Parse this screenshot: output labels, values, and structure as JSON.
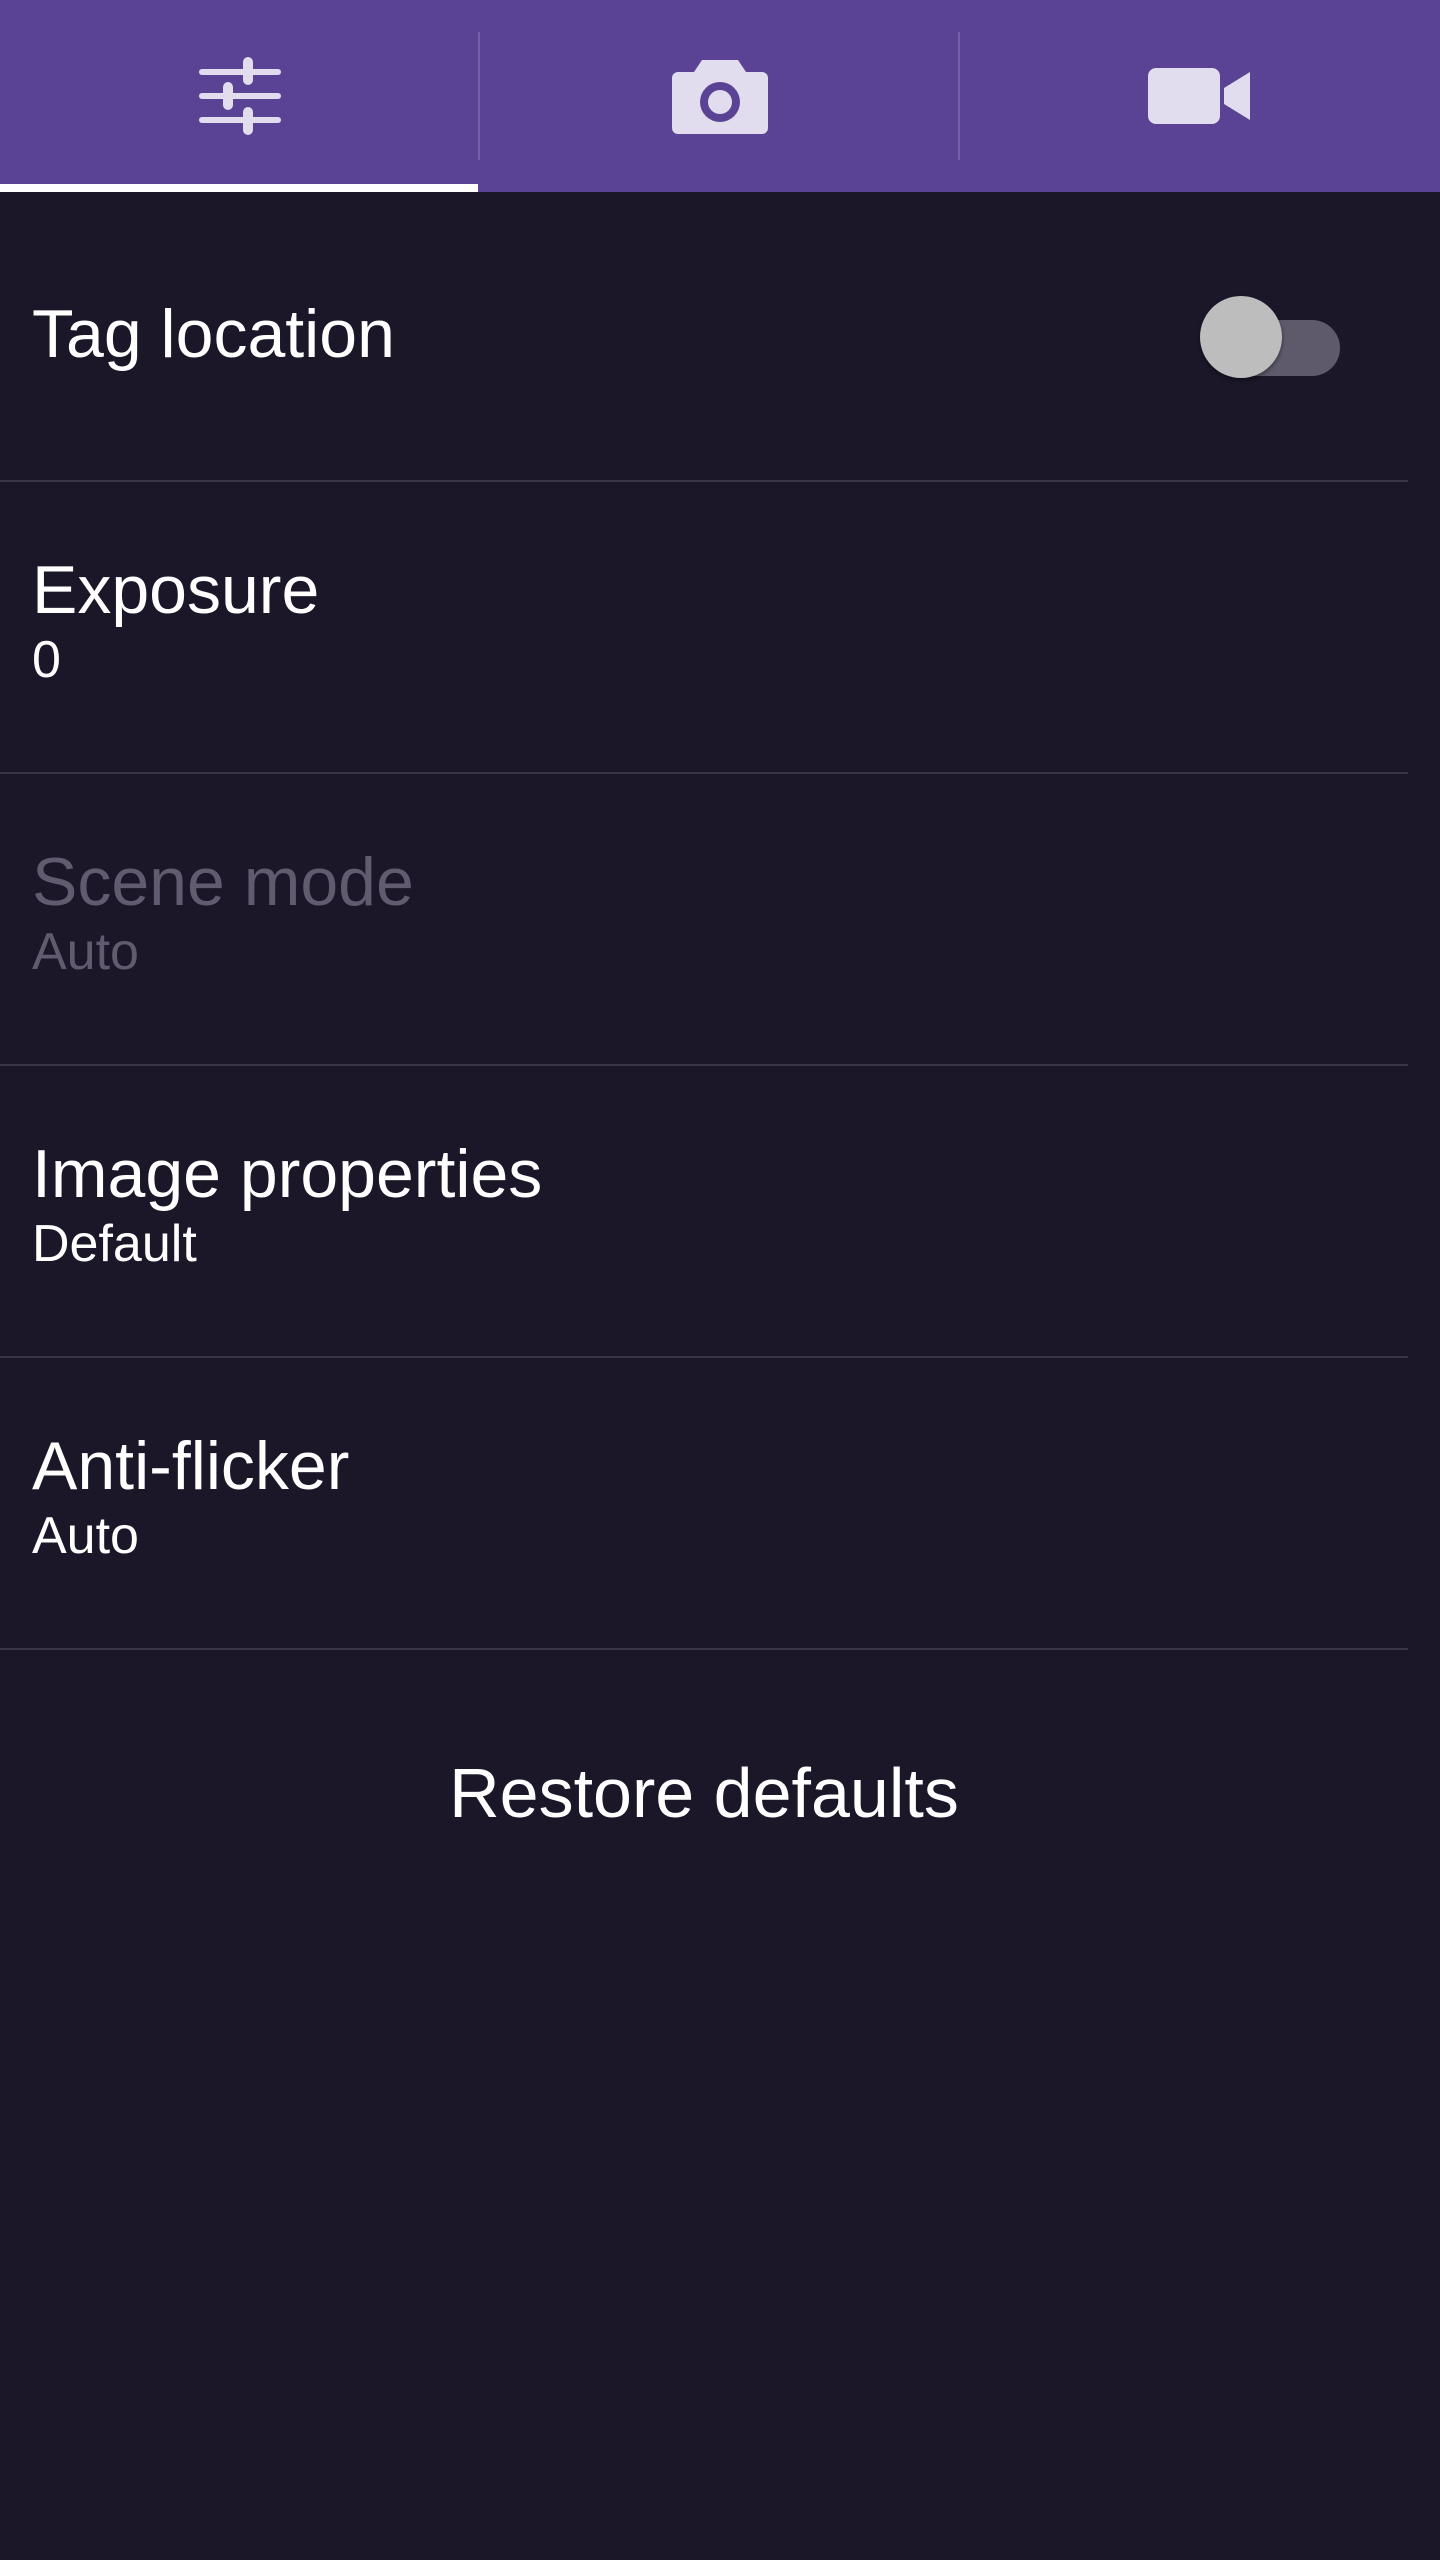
{
  "tabs": [
    {
      "icon": "sliders-icon",
      "selected": true
    },
    {
      "icon": "camera-icon",
      "selected": false
    },
    {
      "icon": "video-camera-icon",
      "selected": false
    }
  ],
  "colors": {
    "tab_bar": "#5a4394",
    "background": "#1b1729",
    "tab_icon": "#e2dcef",
    "divider": "#3a3545",
    "disabled_text": "#625b70"
  },
  "settings": {
    "tag_location": {
      "title": "Tag location",
      "enabled": false
    },
    "exposure": {
      "title": "Exposure",
      "value": "0"
    },
    "scene_mode": {
      "title": "Scene mode",
      "value": "Auto",
      "disabled": true
    },
    "image_properties": {
      "title": "Image properties",
      "value": "Default"
    },
    "anti_flicker": {
      "title": "Anti-flicker",
      "value": "Auto"
    }
  },
  "restore_label": "Restore defaults"
}
